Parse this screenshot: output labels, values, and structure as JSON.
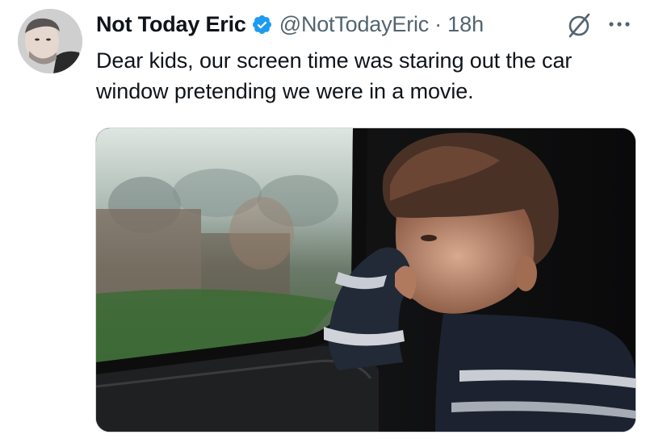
{
  "tweet": {
    "author": {
      "display_name": "Not Today Eric",
      "handle": "@NotTodayEric",
      "verified": true,
      "avatar_icon": "avatar-photo"
    },
    "separator": "·",
    "time": "18h",
    "text": "Dear kids, our screen time was staring out the car window pretending we were in a movie.",
    "icons": {
      "grok": "grok-slash-icon",
      "more": "more-icon"
    },
    "media": {
      "type": "photo",
      "alt_icon": "photo-boy-at-car-window"
    },
    "colors": {
      "verified_blue": "#1d9bf0",
      "secondary_text": "#536471",
      "primary_text": "#0f1419"
    }
  }
}
